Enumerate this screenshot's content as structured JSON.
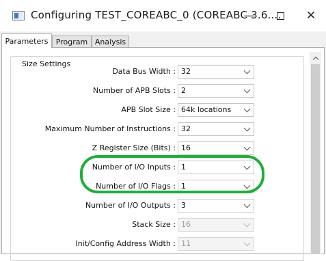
{
  "window": {
    "title": "Configuring TEST_COREABC_0 (COREABC 3.6....",
    "icon": "app-window-icon",
    "controls": {
      "minimize": "—",
      "close": "✕"
    }
  },
  "tabs": [
    {
      "label": "Parameters",
      "active": true
    },
    {
      "label": "Program",
      "active": false
    },
    {
      "label": "Analysis",
      "active": false
    }
  ],
  "group": {
    "title": "Size Settings"
  },
  "settings": [
    {
      "label": "Data Bus Width :",
      "value": "32",
      "enabled": true
    },
    {
      "label": "Number of APB Slots :",
      "value": "2",
      "enabled": true
    },
    {
      "label": "APB Slot Size :",
      "value": "64k locations",
      "enabled": true
    },
    {
      "label": "Maximum Number of Instructions :",
      "value": "32",
      "enabled": true
    },
    {
      "label": "Z Register Size (Bits) :",
      "value": "16",
      "enabled": true
    },
    {
      "label": "Number of I/O Inputs :",
      "value": "1",
      "enabled": true
    },
    {
      "label": "Number of I/O Flags :",
      "value": "1",
      "enabled": true
    },
    {
      "label": "Number of I/O Outputs :",
      "value": "3",
      "enabled": true
    },
    {
      "label": "Stack Size :",
      "value": "16",
      "enabled": false
    },
    {
      "label": "Init/Config Address Width :",
      "value": "11",
      "enabled": false
    }
  ],
  "annotation": {
    "color": "#1fae3a"
  }
}
